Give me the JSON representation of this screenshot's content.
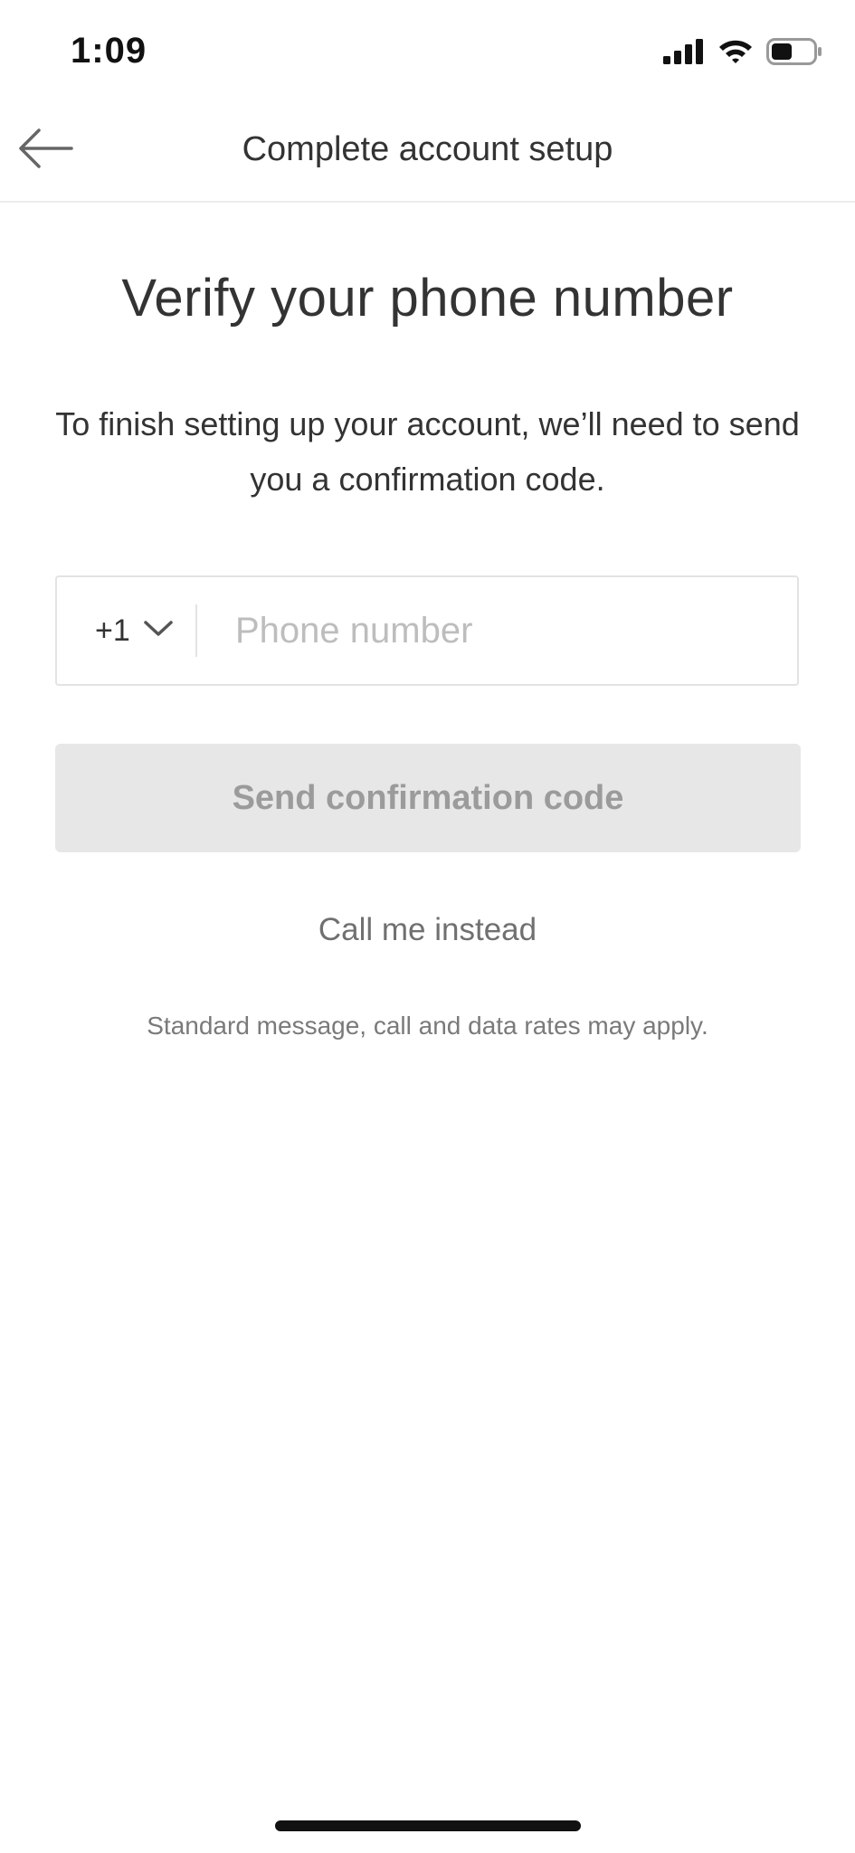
{
  "status_bar": {
    "time": "1:09"
  },
  "nav": {
    "title": "Complete account setup",
    "back_icon": "arrow-left-icon"
  },
  "main": {
    "heading": "Verify your phone number",
    "description": "To finish setting up your account, we’ll need to send you a confirmation code.",
    "phone": {
      "country_code": "+1",
      "placeholder": "Phone number",
      "value": ""
    },
    "send_button_label": "Send confirmation code",
    "call_link_label": "Call me instead",
    "rates_note": "Standard message, call and data rates may apply."
  },
  "colors": {
    "text": "#333333",
    "placeholder": "#bdbdbd",
    "button_disabled_bg": "#e7e7e7",
    "button_disabled_text": "#9b9b9b",
    "muted_text": "#707070"
  }
}
